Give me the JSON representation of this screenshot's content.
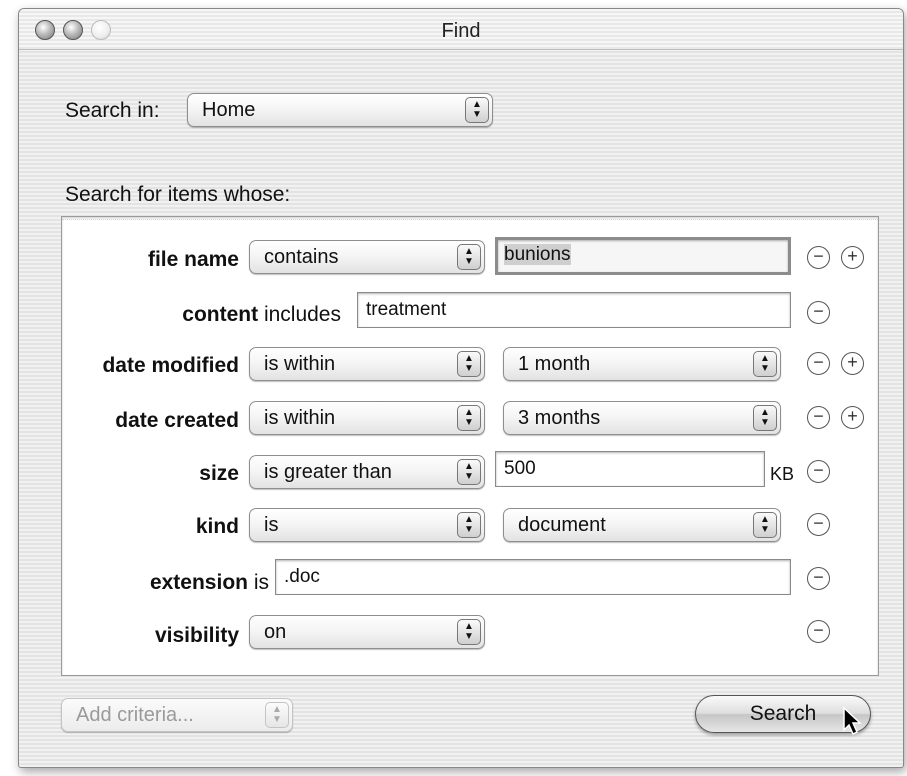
{
  "window": {
    "title": "Find"
  },
  "search_in": {
    "label": "Search in:",
    "value": "Home"
  },
  "criteria_header": "Search for items whose:",
  "rows": {
    "file_name": {
      "label": "file name",
      "operator": "contains",
      "value": "bunions"
    },
    "content": {
      "label": "content",
      "suffix": "includes",
      "value": "treatment"
    },
    "date_modified": {
      "label": "date modified",
      "operator": "is within",
      "value": "1 month"
    },
    "date_created": {
      "label": "date created",
      "operator": "is within",
      "value": "3 months"
    },
    "size": {
      "label": "size",
      "operator": "is greater than",
      "value": "500",
      "unit": "KB"
    },
    "kind": {
      "label": "kind",
      "operator": "is",
      "value": "document"
    },
    "extension": {
      "label": "extension",
      "suffix": "is",
      "value": ".doc"
    },
    "visibility": {
      "label": "visibility",
      "value": "on"
    }
  },
  "buttons": {
    "remove_glyph": "−",
    "add_glyph": "+"
  },
  "add_criteria": {
    "placeholder": "Add criteria..."
  },
  "search_button": {
    "label": "Search"
  },
  "icons": {
    "close": "close-icon",
    "minimize": "minimize-icon",
    "zoom": "zoom-icon",
    "popup_arrows": "updown-arrows-icon",
    "cursor": "mouse-pointer-icon"
  }
}
